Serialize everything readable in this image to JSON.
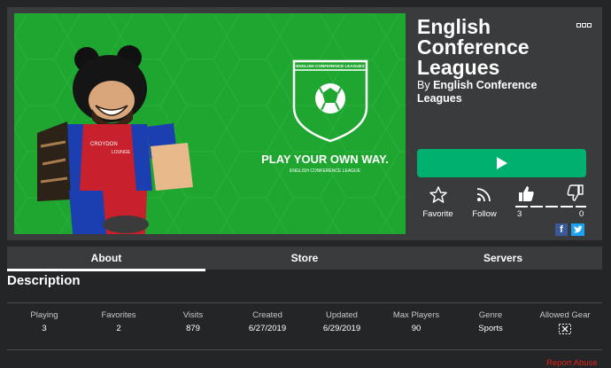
{
  "game": {
    "title": "English Conference Leagues",
    "by_prefix": "By",
    "creator": "English Conference Leagues"
  },
  "thumbnail": {
    "badge_text": "ENGLISH CONFERENCE LEAGUES",
    "slogan": "PLAY YOUR OWN WAY.",
    "sub_slogan": "ENGLISH CONFERENCE LEAGUE",
    "shirt_text": "CROYDON",
    "shirt_text2": "LOUNGE",
    "background_color": "#1fa631"
  },
  "actions": {
    "play_icon": "play-icon",
    "favorite_label": "Favorite",
    "follow_label": "Follow",
    "upvotes": "3",
    "downvotes": "0"
  },
  "share": {
    "facebook_glyph": "f"
  },
  "tabs": [
    {
      "label": "About",
      "active": true
    },
    {
      "label": "Store",
      "active": false
    },
    {
      "label": "Servers",
      "active": false
    }
  ],
  "description": {
    "heading": "Description"
  },
  "stats": [
    {
      "label": "Playing",
      "value": "3"
    },
    {
      "label": "Favorites",
      "value": "2"
    },
    {
      "label": "Visits",
      "value": "879"
    },
    {
      "label": "Created",
      "value": "6/27/2019"
    },
    {
      "label": "Updated",
      "value": "6/29/2019"
    },
    {
      "label": "Max Players",
      "value": "90"
    },
    {
      "label": "Genre",
      "value": "Sports"
    },
    {
      "label": "Allowed Gear",
      "value": ""
    }
  ],
  "footer": {
    "report_label": "Report Abuse"
  },
  "colors": {
    "play_green": "#00b06f",
    "report_red": "#e2231a",
    "panel": "#393b3d",
    "page": "#232527"
  }
}
